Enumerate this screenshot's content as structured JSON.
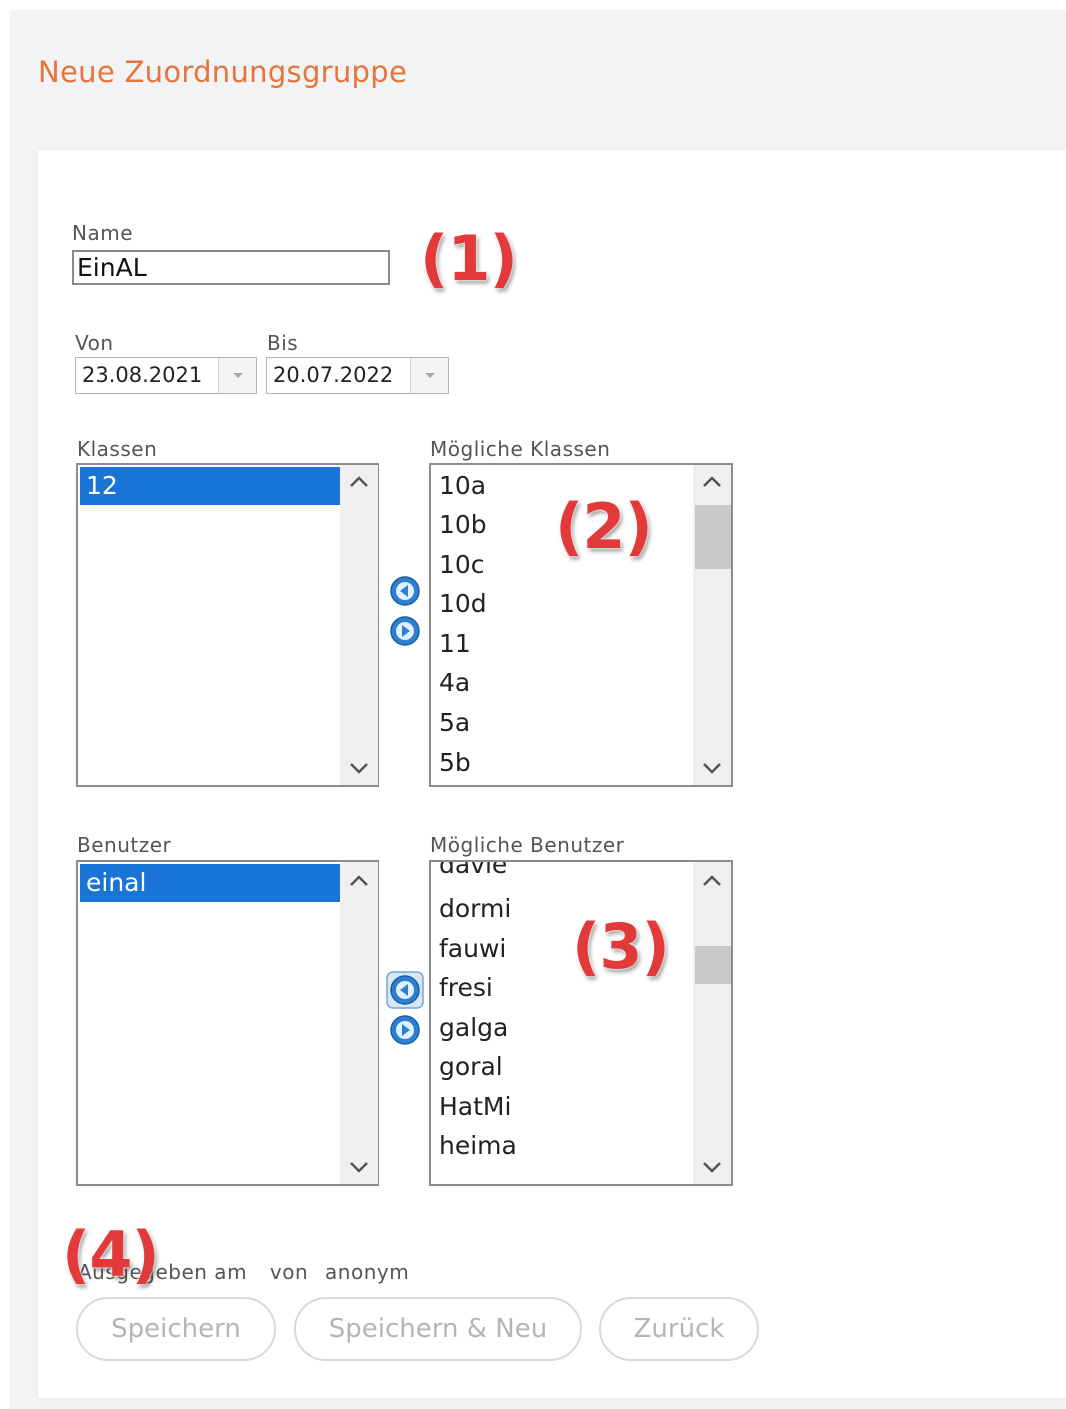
{
  "page": {
    "title": "Neue Zuordnungsgruppe"
  },
  "form": {
    "name": {
      "label": "Name",
      "value": "EinAL"
    },
    "von": {
      "label": "Von",
      "value": "23.08.2021"
    },
    "bis": {
      "label": "Bis",
      "value": "20.07.2022"
    }
  },
  "klassen": {
    "label": "Klassen",
    "selected": [
      "12"
    ],
    "possible_label": "Mögliche Klassen",
    "possible": [
      "10a",
      "10b",
      "10c",
      "10d",
      "11",
      "4a",
      "5a",
      "5b"
    ]
  },
  "benutzer": {
    "label": "Benutzer",
    "selected": [
      "einal"
    ],
    "possible_label": "Mögliche Benutzer",
    "possible": [
      "davie",
      "dormi",
      "fauwi",
      "fresi",
      "galga",
      "goral",
      "HatMi",
      "heima"
    ]
  },
  "meta": {
    "given_label": "Ausgegeben am",
    "by_label": "von",
    "by_value": "anonym"
  },
  "buttons": {
    "save": "Speichern",
    "save_new": "Speichern & Neu",
    "back": "Zurück"
  },
  "annotations": [
    "(1)",
    "(2)",
    "(3)",
    "(4)"
  ],
  "colors": {
    "title": "#e8743b",
    "selection": "#1874d6",
    "annotation": "#e23a3a",
    "arrow_icon": "#2f7fd0"
  },
  "icons": [
    "chevron-up-icon",
    "chevron-down-icon",
    "arrow-left-circle-icon",
    "arrow-right-circle-icon",
    "calendar-dropdown-icon"
  ]
}
